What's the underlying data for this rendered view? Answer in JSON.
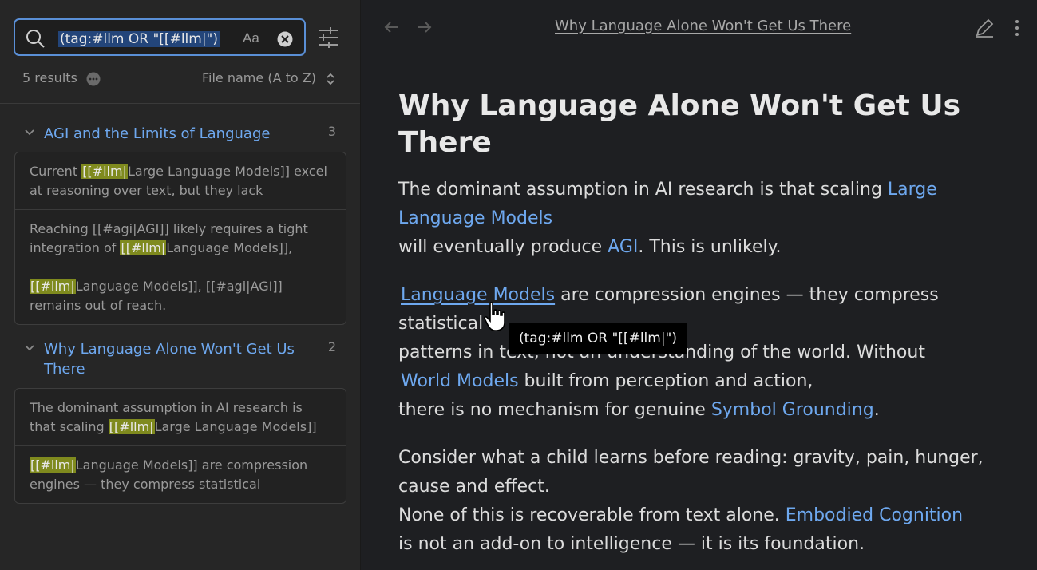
{
  "search": {
    "query": "(tag:#llm OR \"[[#llm|\")",
    "match_case_label": "Aa"
  },
  "results": {
    "count_label": "5 results",
    "sort_label": "File name (A to Z)"
  },
  "groups": [
    {
      "title": "AGI and the Limits of Language",
      "count": "3",
      "cards": [
        {
          "pre": "Current ",
          "hl": "[[#llm|",
          "post": "Large Language Models]] excel at reasoning over text, but they lack"
        },
        {
          "pre": "Reaching [[#agi|AGI]] likely requires a tight integration of ",
          "hl": "[[#llm|",
          "post": "Language Models]],"
        },
        {
          "pre": "",
          "hl": "[[#llm|",
          "post": "Language Models]], [[#agi|AGI]] remains out of reach."
        }
      ]
    },
    {
      "title": "Why Language Alone Won't Get Us There",
      "count": "2",
      "cards": [
        {
          "pre": "The dominant assumption in AI research is that scaling ",
          "hl": "[[#llm|",
          "post": "Large Language Models]]"
        },
        {
          "pre": "",
          "hl": "[[#llm|",
          "post": "Language Models]] are compression engines — they compress statistical"
        }
      ]
    }
  ],
  "tab": {
    "title": "Why Language Alone Won't Get Us There"
  },
  "doc": {
    "title": "Why Language Alone Won't Get Us There",
    "p1": {
      "a": "The dominant assumption in AI research is that scaling ",
      "link1": "Large Language Models",
      "b": "will eventually produce ",
      "link2": "AGI",
      "c": ". This is unlikely."
    },
    "p2": {
      "link1": "Language Models",
      "a": " are compression engines — they compress statistical",
      "b": "patterns in text, not an understanding of the world. Without ",
      "link2": "World Models",
      "c": " built from perception and action,",
      "d": "there is no mechanism for genuine ",
      "link3": "Symbol Grounding",
      "e": "."
    },
    "p3": {
      "a": "Consider what a child learns before reading: gravity, pain, hunger, cause and effect.",
      "b": "None of this is recoverable from text alone. ",
      "link1": "Embodied Cognition",
      "c": "is not an add-on to intelligence — it is its foundation."
    }
  },
  "tooltip": {
    "text": "(tag:#llm OR \"[[#llm|\")"
  },
  "colors": {
    "accent": "#6ea8ef",
    "highlight": "#7f8a1e",
    "focus_border": "#5a8fd6"
  }
}
